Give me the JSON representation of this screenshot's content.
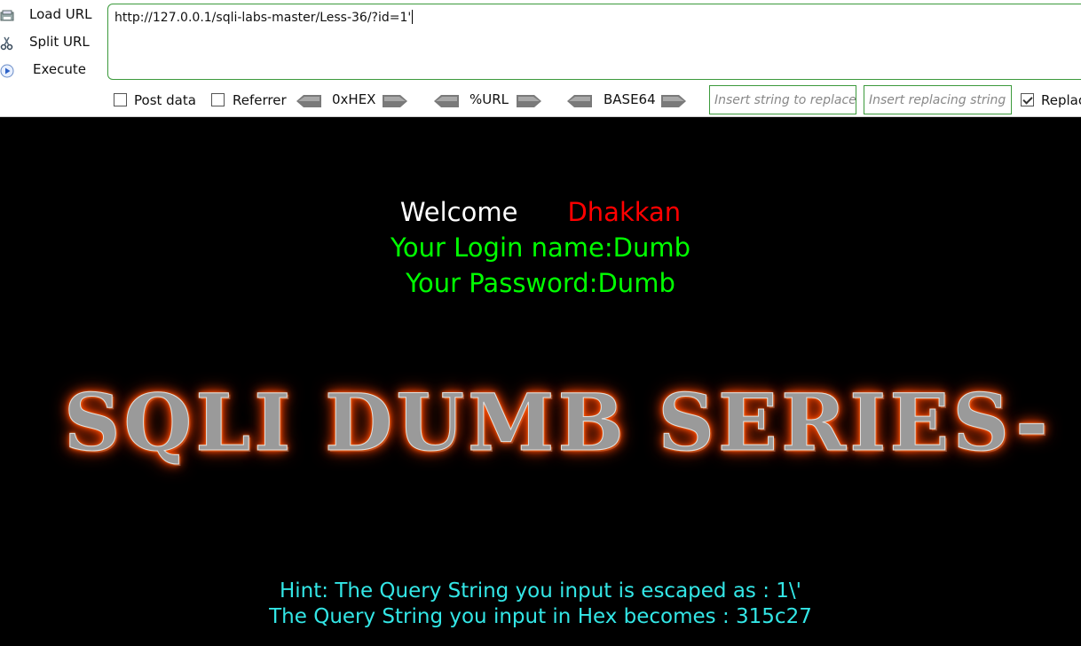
{
  "toolbar": {
    "load_url": "Load URL",
    "split_url": "Split URL",
    "execute": "Execute",
    "url_value": "http://127.0.0.1/sqli-labs-master/Less-36/?id=1'",
    "post_data": "Post data",
    "referrer": "Referrer",
    "hex": "0xHEX",
    "url_enc": "%URL",
    "base64": "BASE64",
    "replace_from_placeholder": "Insert string to replace",
    "replace_to_placeholder": "Insert replacing string",
    "replace_all": "Replac"
  },
  "page": {
    "welcome": "Welcome",
    "user": "Dhakkan",
    "login_name": "Your Login name:Dumb",
    "password": "Your Password:Dumb",
    "banner": "SQLI DUMB SERIES-",
    "hint1": "Hint: The Query String you input is escaped as : 1\\'",
    "hint2": "The Query String you input in Hex becomes : 315c27"
  },
  "colors": {
    "welcome": "#ffffff",
    "user": "#ff0000",
    "login": "#00ff00",
    "hint": "#33e6e6",
    "banner_glow": "#ff5500"
  }
}
